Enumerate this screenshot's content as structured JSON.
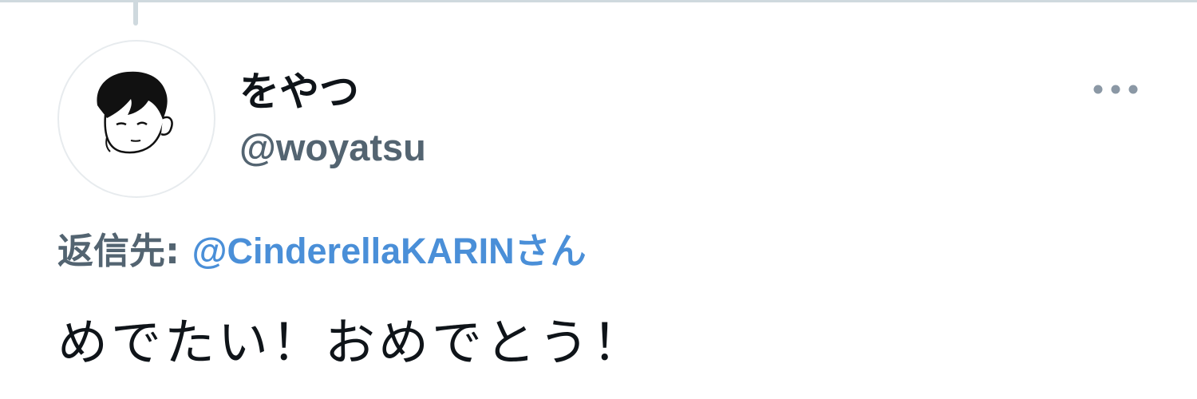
{
  "tweet": {
    "author": {
      "display_name": "をやつ",
      "handle": "@woyatsu",
      "avatar_icon": "avatar-illustration"
    },
    "reply": {
      "prefix": "返信先: ",
      "target_handle": "@CinderellaKARIN",
      "suffix": "さん"
    },
    "text": "めでたい！おめでとう！",
    "more_icon": "more-dots-icon"
  },
  "colors": {
    "primary_text": "#0f1419",
    "secondary_text": "#536471",
    "link": "#4a8fd8",
    "divider": "#cfd9de"
  }
}
